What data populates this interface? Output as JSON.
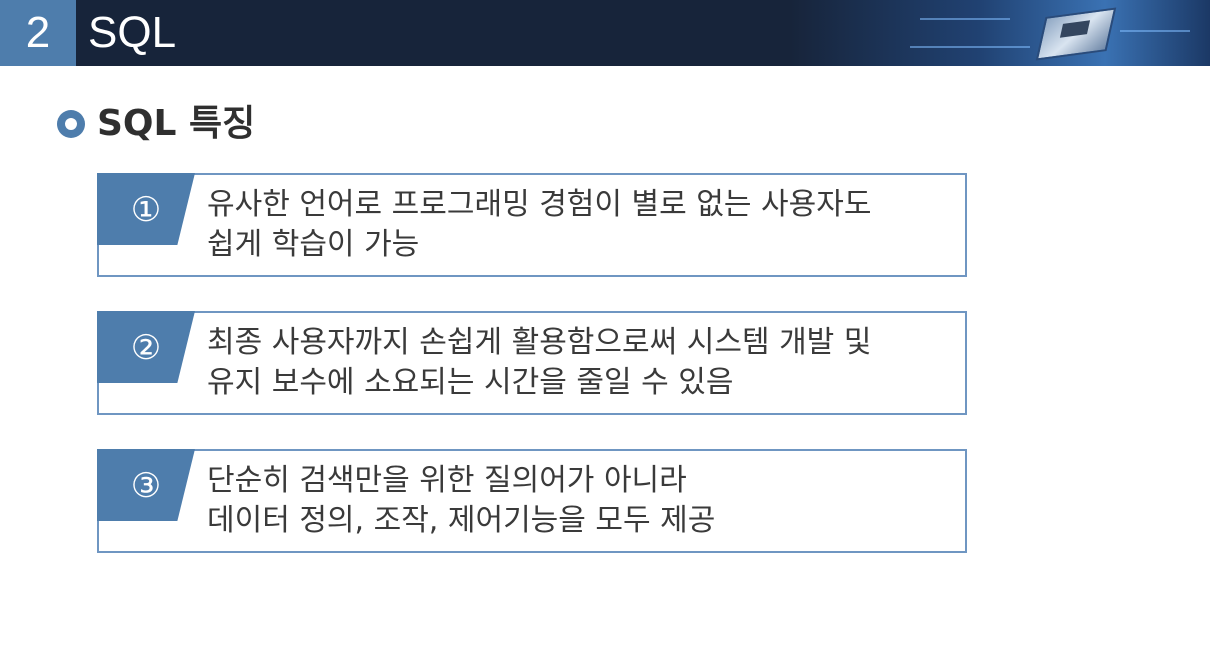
{
  "header": {
    "section_number": "2",
    "section_title": "SQL"
  },
  "main": {
    "subtitle": "SQL 특징",
    "items": [
      {
        "marker": "①",
        "line1": "유사한 언어로 프로그래밍 경험이 별로 없는 사용자도",
        "line2": "쉽게 학습이 가능"
      },
      {
        "marker": "②",
        "line1": "최종 사용자까지 손쉽게 활용함으로써 시스템 개발 및",
        "line2": "유지 보수에 소요되는 시간을 줄일 수 있음"
      },
      {
        "marker": "③",
        "line1": "단순히 검색만을 위한 질의어가 아니라",
        "line2": "데이터 정의, 조작, 제어기능을 모두 제공"
      }
    ]
  },
  "colors": {
    "header_bg": "#17243a",
    "accent": "#4e7dac",
    "card_border": "#6f96c2",
    "text": "#3a3a3a"
  }
}
